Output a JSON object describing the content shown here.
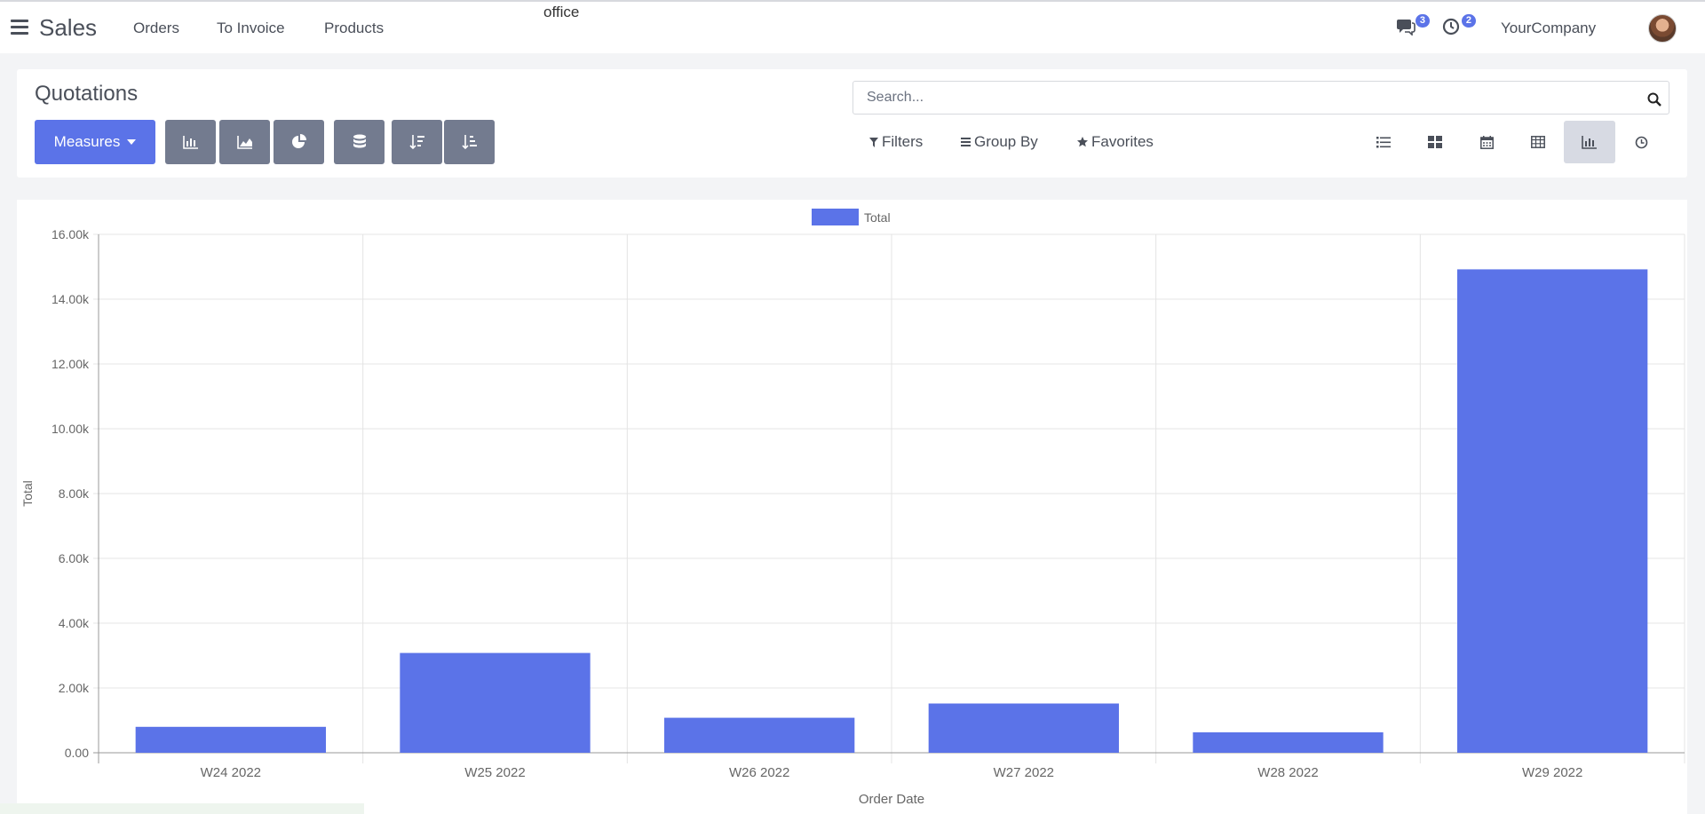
{
  "nav": {
    "app_name": "Sales",
    "items": [
      "Orders",
      "To Invoice",
      "Products"
    ],
    "office_label": "office",
    "messages_count": "3",
    "activities_count": "2",
    "company": "YourCompany"
  },
  "control": {
    "title": "Quotations",
    "measures_label": "Measures",
    "search_placeholder": "Search...",
    "filters_label": "Filters",
    "group_by_label": "Group By",
    "favorites_label": "Favorites",
    "chart_buttons": [
      "bar-chart-icon",
      "area-chart-icon",
      "pie-chart-icon",
      "database-icon",
      "sort-descending-icon",
      "sort-ascending-icon"
    ],
    "views": [
      "list-view-icon",
      "kanban-view-icon",
      "calendar-view-icon",
      "pivot-view-icon",
      "graph-view-icon",
      "activity-view-icon"
    ],
    "active_view": "graph-view-icon"
  },
  "chart_data": {
    "type": "bar",
    "categories": [
      "W24 2022",
      "W25 2022",
      "W26 2022",
      "W27 2022",
      "W28 2022",
      "W29 2022"
    ],
    "series": [
      {
        "name": "Total",
        "values": [
          800,
          3080,
          1080,
          1520,
          630,
          14920
        ]
      }
    ],
    "xlabel": "Order Date",
    "ylabel": "Total",
    "ylim": [
      0,
      16000
    ],
    "yticks": [
      "0.00",
      "2.00k",
      "4.00k",
      "6.00k",
      "8.00k",
      "10.00k",
      "12.00k",
      "14.00k",
      "16.00k"
    ],
    "grid": true,
    "legend": "top-center",
    "color": "#5b73e8"
  }
}
